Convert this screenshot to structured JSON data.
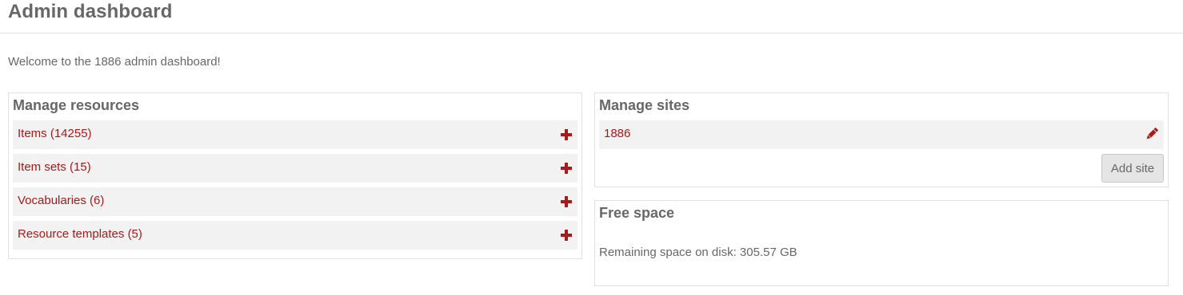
{
  "header": {
    "title": "Admin dashboard"
  },
  "welcome": "Welcome to the 1886 admin dashboard!",
  "resources": {
    "title": "Manage resources",
    "items": [
      {
        "label": "Items (14255)",
        "action_icon": "plus-icon"
      },
      {
        "label": "Item sets (15)",
        "action_icon": "plus-icon"
      },
      {
        "label": "Vocabularies (6)",
        "action_icon": "plus-icon"
      },
      {
        "label": "Resource templates (5)",
        "action_icon": "plus-icon"
      }
    ]
  },
  "sites": {
    "title": "Manage sites",
    "items": [
      {
        "label": "1886",
        "action_icon": "pencil-icon"
      }
    ],
    "add_button": "Add site"
  },
  "free_space": {
    "title": "Free space",
    "text": "Remaining space on disk: 305.57 GB"
  },
  "colors": {
    "accent": "#a91919",
    "text": "#676767",
    "row_background": "#f2f2f2",
    "border": "#dfdfdf"
  }
}
